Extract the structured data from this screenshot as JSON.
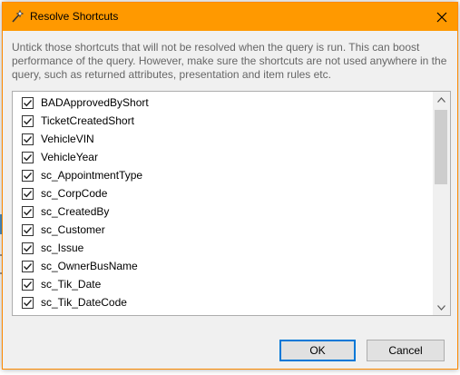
{
  "dialog": {
    "title": "Resolve Shortcuts",
    "description": "Untick those shortcuts that will not be resolved when the query is run. This can boost performance of the query. However, make sure the shortcuts are not used anywhere in the query, such as returned attributes, presentation and item rules etc.",
    "ok_label": "OK",
    "cancel_label": "Cancel"
  },
  "shortcuts": [
    {
      "label": "BADApprovedByShort",
      "checked": true
    },
    {
      "label": "TicketCreatedShort",
      "checked": true
    },
    {
      "label": "VehicleVIN",
      "checked": true
    },
    {
      "label": "VehicleYear",
      "checked": true
    },
    {
      "label": "sc_AppointmentType",
      "checked": true
    },
    {
      "label": "sc_CorpCode",
      "checked": true
    },
    {
      "label": "sc_CreatedBy",
      "checked": true
    },
    {
      "label": "sc_Customer",
      "checked": true
    },
    {
      "label": "sc_Issue",
      "checked": true
    },
    {
      "label": "sc_OwnerBusName",
      "checked": true
    },
    {
      "label": "sc_Tik_Date",
      "checked": true
    },
    {
      "label": "sc_Tik_DateCode",
      "checked": true
    }
  ],
  "colors": {
    "titlebar": "#ff9900",
    "default_button_border": "#0078d7"
  }
}
